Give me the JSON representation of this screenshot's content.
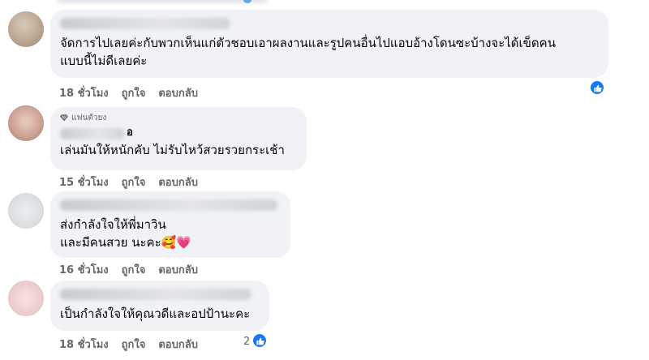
{
  "comments": [
    {
      "text_line1": "จัดการไปเลยค่ะกับพวกเห็นแก่ตัวชอบเอาผลงานและรูปคนอื่นไปแอบอ้างโดนซะบ้างจะได้เข็ดคน",
      "text_line2": "แบบนี้ไม่ดีเลยค่ะ",
      "time": "18 ชั่วโมง",
      "like_label": "ถูกใจ",
      "reply_label": "ตอบกลับ",
      "reaction_count": ""
    },
    {
      "badge": "แฟนตัวยง",
      "name_tail": "อ",
      "text_line1": "เล่นมันให้หนักคับ ไม่รับไหว้สวยรวยกระเช้า",
      "time": "15 ชั่วโมง",
      "like_label": "ถูกใจ",
      "reply_label": "ตอบกลับ"
    },
    {
      "text_line1": "ส่งกำลังใจให้พี่มาวิน",
      "text_line2": "และมีคนสวย นะคะ",
      "emoji": "🥰💗",
      "time": "16 ชั่วโมง",
      "like_label": "ถูกใจ",
      "reply_label": "ตอบกลับ"
    },
    {
      "text_line1": "เป็นกำลังใจให้คุณวดีและอปป้านะคะ",
      "time": "18 ชั่วโมง",
      "like_label": "ถูกใจ",
      "reply_label": "ตอบกลับ",
      "reaction_count": "2"
    }
  ],
  "icons": {
    "like": "thumbs-up-icon",
    "badge": "diamond-icon"
  },
  "colors": {
    "accent": "#1877f2",
    "bubble": "#f0f2f5",
    "meta": "#65676b"
  }
}
